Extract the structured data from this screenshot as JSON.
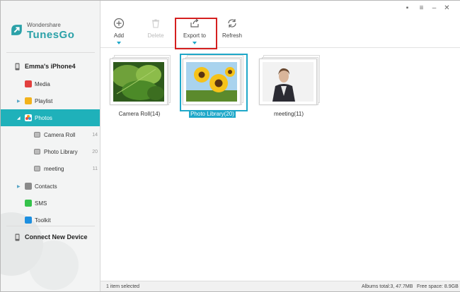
{
  "app": {
    "brand_sub": "Wondershare",
    "brand_main": "TunesGo"
  },
  "sidebar": {
    "device": "Emma's iPhone4",
    "items": [
      {
        "label": "Media"
      },
      {
        "label": "Playlist"
      },
      {
        "label": "Photos"
      },
      {
        "label": "Camera Roll",
        "count": "14"
      },
      {
        "label": "Photo Library",
        "count": "20"
      },
      {
        "label": "meeting",
        "count": "11"
      },
      {
        "label": "Contacts"
      },
      {
        "label": "SMS"
      },
      {
        "label": "Toolkit"
      }
    ],
    "connect_new": "Connect New Device"
  },
  "toolbar": {
    "add": "Add",
    "delete": "Delete",
    "export": "Export to",
    "refresh": "Refresh"
  },
  "albums": [
    {
      "caption": "Camera Roll(14)"
    },
    {
      "caption": "Photo Library(20)"
    },
    {
      "caption": "meeting(11)"
    }
  ],
  "status": {
    "selected": "1 item selected",
    "albums_total": "Albums total:3, 47.7MB",
    "free_space": "Free space: 8.9GB"
  },
  "colors": {
    "accent": "#1fb1ba",
    "selection": "#1fa8c9",
    "highlight": "#d51f1f"
  }
}
